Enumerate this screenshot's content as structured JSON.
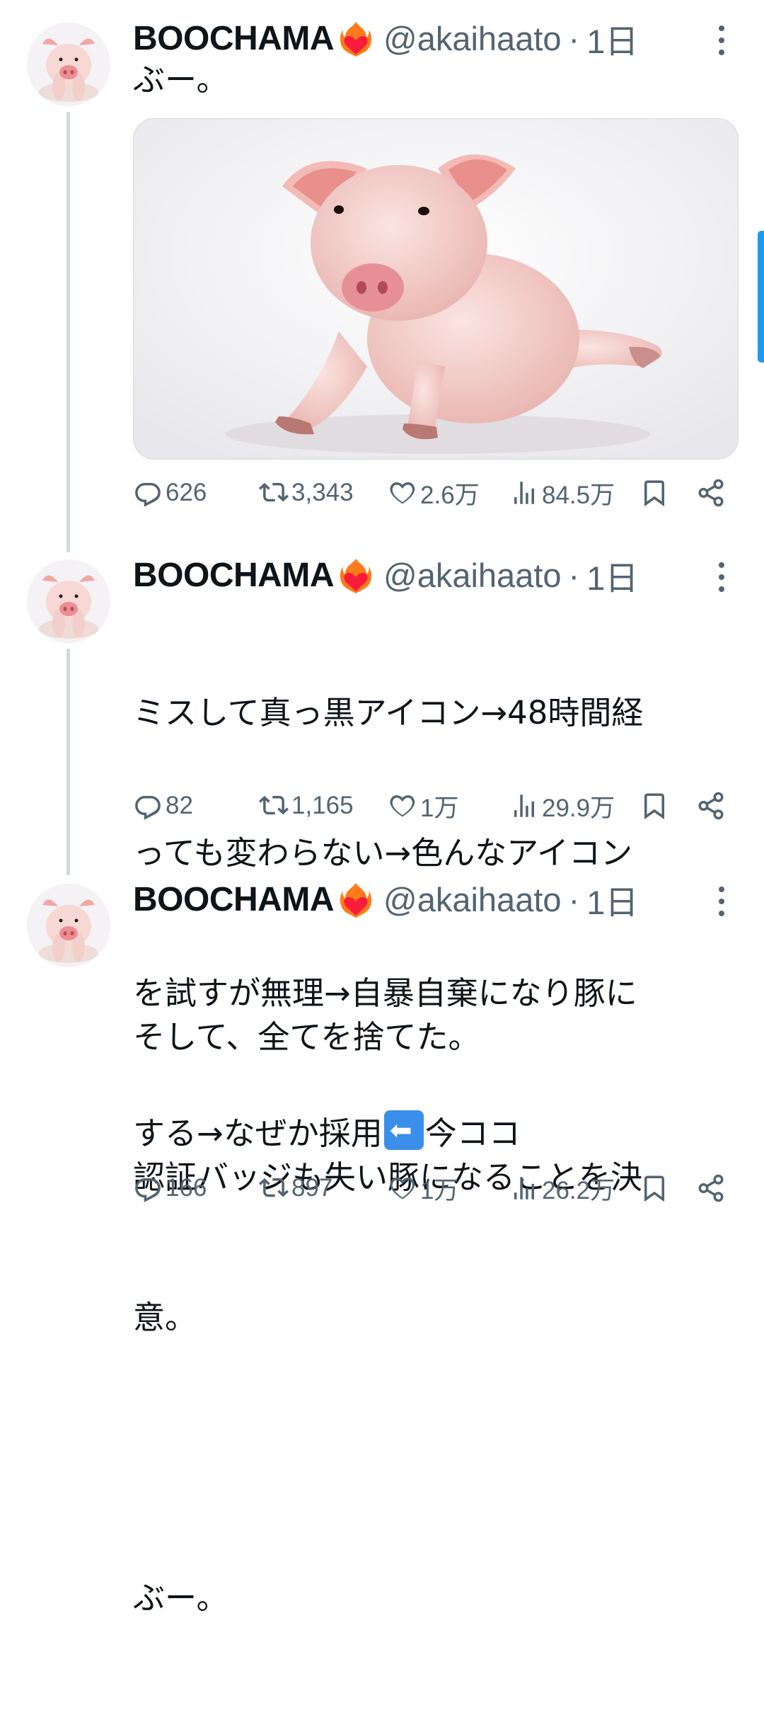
{
  "colors": {
    "secondary_text": "#536471",
    "primary_text": "#0f1419",
    "thread_line": "#cfd9de",
    "accent": "#1d9bf0"
  },
  "tweets": [
    {
      "name": "BOOCHAMA",
      "handle": "@akaihaato",
      "dot": "·",
      "time": "1日",
      "text": "ぶー。",
      "has_media": true,
      "media_description_icon": "pig-photo",
      "replies": "626",
      "retweets": "3,343",
      "likes": "2.6万",
      "views": "84.5万"
    },
    {
      "name": "BOOCHAMA",
      "handle": "@akaihaato",
      "dot": "·",
      "time": "1日",
      "text_lines": [
        "ミスして真っ黒アイコン→48時間経",
        "っても変わらない→色んなアイコン",
        "を試すが無理→自暴自棄になり豚に",
        "する→なぜか採用"
      ],
      "text_suffix": "今ココ",
      "replies": "82",
      "retweets": "1,165",
      "likes": "1万",
      "views": "29.9万"
    },
    {
      "name": "BOOCHAMA",
      "handle": "@akaihaato",
      "dot": "·",
      "time": "1日",
      "text_lines": [
        "そして、全てを捨てた。",
        "認証バッジも失い豚になることを決",
        "意。",
        "",
        "ぶー。"
      ],
      "replies": "166",
      "retweets": "897",
      "likes": "1万",
      "views": "26.2万"
    }
  ]
}
